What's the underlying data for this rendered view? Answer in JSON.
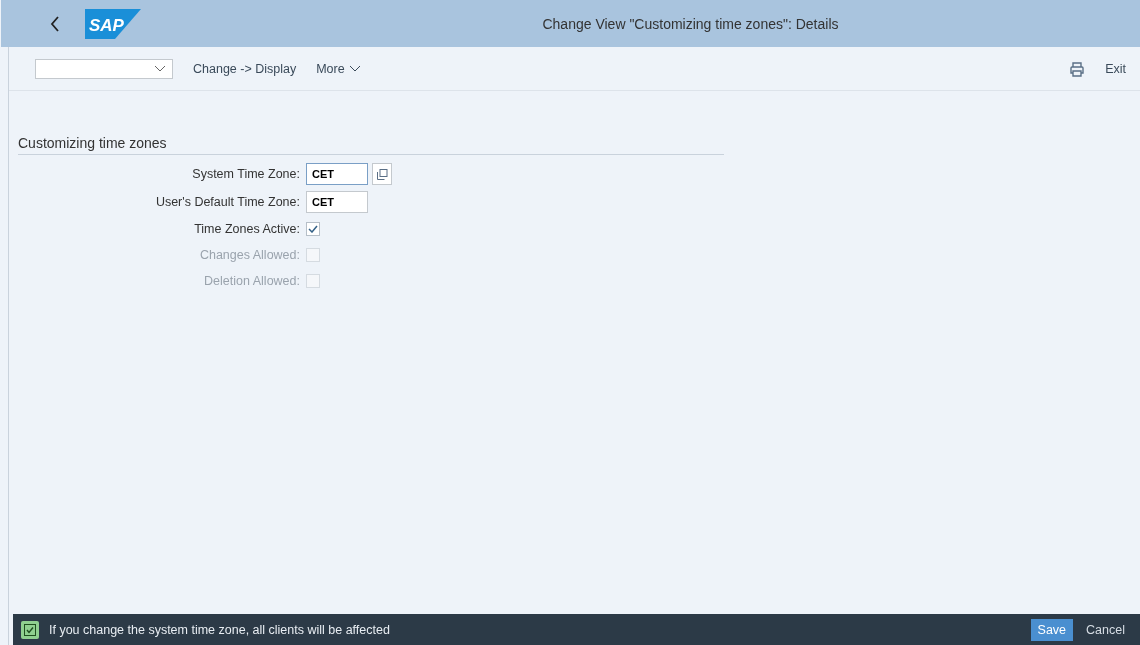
{
  "header": {
    "logo": "SAP",
    "title": "Change View \"Customizing time zones\": Details"
  },
  "toolbar": {
    "actions": [
      "Change -> Display",
      "More"
    ],
    "exit": "Exit"
  },
  "section": {
    "title": "Customizing time zones",
    "fields": [
      {
        "kind": "input",
        "label": "System Time Zone:",
        "value": "CET",
        "focused": true,
        "help": true
      },
      {
        "kind": "input",
        "label": "User's Default Time Zone:",
        "value": "CET",
        "focused": false,
        "help": false
      },
      {
        "kind": "checkbox",
        "label": "Time Zones Active:",
        "checked": true,
        "disabled": false
      },
      {
        "kind": "checkbox",
        "label": "Changes Allowed:",
        "checked": false,
        "disabled": true
      },
      {
        "kind": "checkbox",
        "label": "Deletion Allowed:",
        "checked": false,
        "disabled": true
      }
    ]
  },
  "footer": {
    "message": "If you change the system time zone, all clients will be affected",
    "buttons": [
      {
        "label": "Save",
        "primary": true
      },
      {
        "label": "Cancel",
        "primary": false
      }
    ]
  }
}
